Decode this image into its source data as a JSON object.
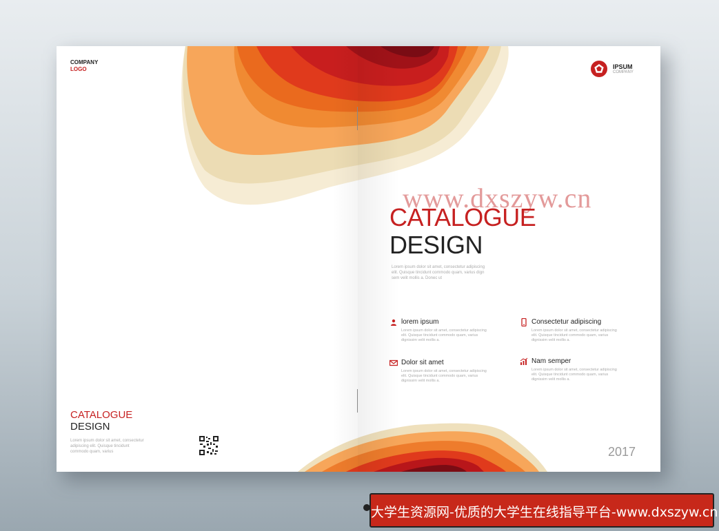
{
  "left_page": {
    "company_logo": {
      "line1": "COMPANY",
      "line2": "LOGO"
    },
    "title_line1": "CATALOGUE",
    "title_line2": "DESIGN",
    "body": "Lorem ipsum dolor sit amet, consectetur adipiscing elit. Quisque tincidunt commodo quam, varius"
  },
  "right_page": {
    "brand": {
      "name": "IPSUM",
      "sub": "COMPANY",
      "icon": "pentagon-logo-icon"
    },
    "watermark": "www.dxszyw.cn",
    "title_line1": "CATALOGUE",
    "title_line2": "DESIGN",
    "intro": "Lorem ipsum dolor sit amet, consectetur adipiscing elit. Quisque tincidunt commodo quam, varius dign sem velit mollis a. Donec ut",
    "features": [
      {
        "icon": "user-icon",
        "title": "lorem ipsum",
        "text": "Lorem ipsum dolor sit amet, consectetur adipiscing elit. Quisque tincidunt commodo quam, varius dignissim velit mollis a."
      },
      {
        "icon": "phone-icon",
        "title": "Consectetur adipiscing",
        "text": "Lorem ipsum dolor sit amet, consectetur adipiscing elit. Quisque tincidunt commodo quam, varius dignissim velit mollis a."
      },
      {
        "icon": "mail-icon",
        "title": "Dolor sit amet",
        "text": "Lorem ipsum dolor sit amet, consectetur adipiscing elit. Quisque tincidunt commodo quam, varius dignissim velit mollis a."
      },
      {
        "icon": "chart-icon",
        "title": "Nam semper",
        "text": "Lorem ipsum dolor sit amet, consectetur adipiscing elit. Quisque tincidunt commodo quam, varius dignissim velit mollis a."
      }
    ],
    "year": "2017"
  },
  "banner": {
    "text": "大学生资源网-优质的大学生在线指导平台-www.dxszyw.cn"
  },
  "colors": {
    "accent": "#c62121",
    "banner": "#c7281a"
  }
}
